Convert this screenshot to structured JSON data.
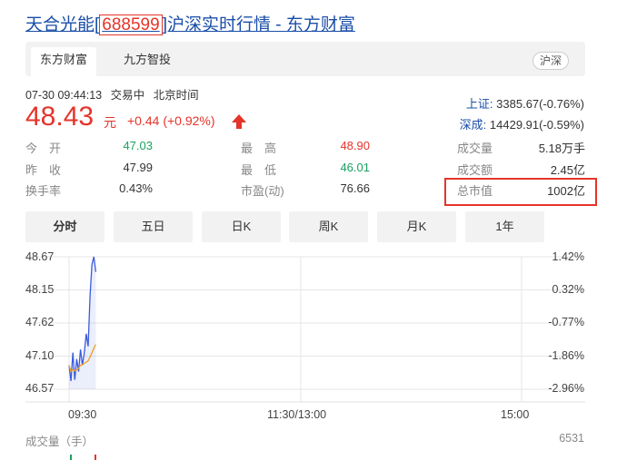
{
  "header": {
    "title_prefix": "天合光能[",
    "code": "688599",
    "title_suffix": "]沪深实时行情 - 东方财富"
  },
  "tabs": [
    {
      "label": "东方财富",
      "active": true
    },
    {
      "label": "九方智投",
      "active": false
    }
  ],
  "market_chip": "沪深",
  "status": {
    "datetime": "07-30 09:44:13",
    "trading": "交易中",
    "timezone": "北京时间"
  },
  "quote": {
    "price": "48.43",
    "unit": "元",
    "change": "+0.44 (+0.92%)",
    "direction": "up"
  },
  "indices": [
    {
      "name": "上证:",
      "value": "3385.67(-0.76%)"
    },
    {
      "name": "深成:",
      "value": "14429.91(-0.59%)"
    }
  ],
  "stats": {
    "col1": [
      {
        "label": "今　开",
        "value": "47.03",
        "color": "green"
      },
      {
        "label": "昨　收",
        "value": "47.99",
        "color": "normal"
      },
      {
        "label": "换手率",
        "value": "0.43%",
        "color": "normal"
      }
    ],
    "col2": [
      {
        "label": "最　高",
        "value": "48.90",
        "color": "red"
      },
      {
        "label": "最　低",
        "value": "46.01",
        "color": "green"
      },
      {
        "label": "市盈(动)",
        "value": "76.66",
        "color": "normal"
      }
    ],
    "col3": [
      {
        "label": "成交量",
        "value": "5.18万手",
        "color": "normal"
      },
      {
        "label": "成交额",
        "value": "2.45亿",
        "color": "normal"
      },
      {
        "label": "总市值",
        "value": "1002亿",
        "color": "normal"
      }
    ]
  },
  "periods": [
    {
      "label": "分时",
      "active": true
    },
    {
      "label": "五日",
      "active": false
    },
    {
      "label": "日K",
      "active": false
    },
    {
      "label": "周K",
      "active": false
    },
    {
      "label": "月K",
      "active": false
    },
    {
      "label": "1年",
      "active": false
    }
  ],
  "colors": {
    "up": "#e5342a",
    "down": "#1aa15f",
    "link": "#1a4ea8",
    "price_line": "#3b5bdb",
    "avg_line": "#f0a020"
  },
  "chart_data": {
    "type": "line",
    "y_left_ticks": [
      "48.67",
      "48.15",
      "47.62",
      "47.10",
      "46.57"
    ],
    "y_right_ticks": [
      "1.42%",
      "0.32%",
      "-0.77%",
      "-1.86%",
      "-2.96%"
    ],
    "x_ticks": [
      "09:30",
      "11:30/13:00",
      "15:00"
    ],
    "ylim": [
      46.57,
      48.67
    ],
    "series": [
      {
        "role": "price",
        "x": [
          "09:30",
          "09:31",
          "09:32",
          "09:33",
          "09:34",
          "09:35",
          "09:36",
          "09:37",
          "09:38",
          "09:39",
          "09:40",
          "09:41",
          "09:42",
          "09:43",
          "09:44"
        ],
        "y": [
          46.95,
          46.7,
          47.15,
          46.72,
          47.05,
          46.85,
          47.2,
          46.95,
          47.15,
          47.45,
          47.25,
          48.05,
          48.55,
          48.67,
          48.43
        ]
      },
      {
        "role": "average",
        "x": [
          "09:30",
          "09:31",
          "09:32",
          "09:33",
          "09:34",
          "09:35",
          "09:36",
          "09:37",
          "09:38",
          "09:39",
          "09:40",
          "09:41",
          "09:42",
          "09:43",
          "09:44"
        ],
        "y": [
          46.95,
          46.85,
          46.88,
          46.86,
          46.88,
          46.9,
          46.95,
          46.96,
          46.98,
          47.0,
          47.02,
          47.08,
          47.15,
          47.22,
          47.28
        ]
      }
    ],
    "volume_label": "成交量（手）",
    "volume_max": "6531"
  }
}
